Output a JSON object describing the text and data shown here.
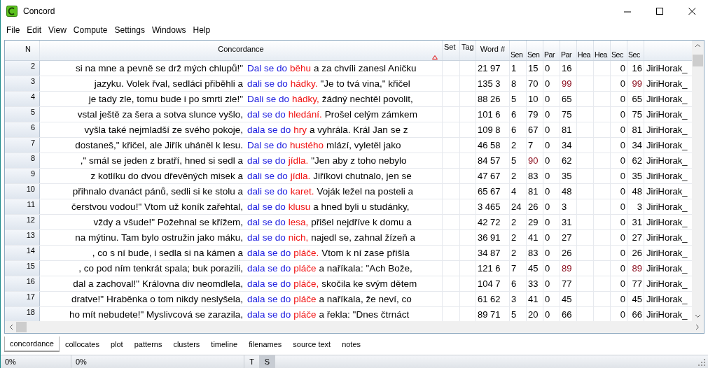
{
  "window": {
    "title": "Concord"
  },
  "menu": [
    "File",
    "Edit",
    "View",
    "Compute",
    "Settings",
    "Windows",
    "Help"
  ],
  "table": {
    "columns": [
      "N",
      "Concordance",
      "Set",
      "Tag",
      "Word #",
      "Sen",
      "Sen",
      "Par",
      "Par",
      "Hea",
      "Hea",
      "Sec",
      "Sec"
    ],
    "rows": [
      {
        "n": "2",
        "left": "si na mne a pevně se drž mých chlupů!\"",
        "node": "Dal se do",
        "collocate": "běhu",
        "right": "a za chvíli zanesl Aničku",
        "word_no": "21 97",
        "sent_1": "1",
        "sent_2": "15",
        "sent_hl": false,
        "para_1": "0",
        "para_2": "16",
        "para_hl": false,
        "sect_1": "0",
        "sect_2": "16",
        "file": "JiriHorak_"
      },
      {
        "n": "3",
        "left": "jazyku. Volek řval, sedláci přiběhli a",
        "node": "dali se do",
        "collocate": "hádky.",
        "right": "\"Je to tvá vina,\" křičel",
        "word_no": "135 3",
        "sent_1": "8",
        "sent_2": "70",
        "sent_hl": false,
        "para_1": "0",
        "para_2": "99",
        "para_hl": true,
        "sect_1": "0",
        "sect_2": "99",
        "file": "JiriHorak_"
      },
      {
        "n": "4",
        "left": "je tady zle, tomu bude i po smrti zle!\"",
        "node": "Dali se do",
        "collocate": "hádky,",
        "right": "žádný nechtěl povolit,",
        "word_no": "88 26",
        "sent_1": "5",
        "sent_2": "10",
        "sent_hl": false,
        "para_1": "0",
        "para_2": "65",
        "para_hl": false,
        "sect_1": "0",
        "sect_2": "65",
        "file": "JiriHorak_"
      },
      {
        "n": "5",
        "left": "vstal ještě za šera a sotva slunce vyšlo,",
        "node": "dal se do",
        "collocate": "hledání.",
        "right": "Prošel celým zámkem",
        "word_no": "101 6",
        "sent_1": "6",
        "sent_2": "79",
        "sent_hl": false,
        "para_1": "0",
        "para_2": "75",
        "para_hl": false,
        "sect_1": "0",
        "sect_2": "75",
        "file": "JiriHorak_"
      },
      {
        "n": "6",
        "left": "vyšla také nejmladší ze svého pokoje,",
        "node": "dala se do",
        "collocate": "hry",
        "right": "a vyhrála. Král Jan se z",
        "word_no": "109 8",
        "sent_1": "6",
        "sent_2": "67",
        "sent_hl": false,
        "para_1": "0",
        "para_2": "81",
        "para_hl": false,
        "sect_1": "0",
        "sect_2": "81",
        "file": "JiriHorak_"
      },
      {
        "n": "7",
        "left": "dostaneš,\" křičel, ale Jiřík uháněl k lesu.",
        "node": "Dal se do",
        "collocate": "hustého",
        "right": "mlází, vyletěl jako",
        "word_no": "46 58",
        "sent_1": "2",
        "sent_2": "7",
        "sent_hl": false,
        "para_1": "0",
        "para_2": "34",
        "para_hl": false,
        "sect_1": "0",
        "sect_2": "34",
        "file": "JiriHorak_"
      },
      {
        "n": "8",
        "left": ",\" smál se jeden z bratří, hned si sedl a",
        "node": "dal se do",
        "collocate": "jídla.",
        "right": "\"Jen aby z toho nebylo",
        "word_no": "84 57",
        "sent_1": "5",
        "sent_2": "90",
        "sent_hl": true,
        "para_1": "0",
        "para_2": "62",
        "para_hl": false,
        "sect_1": "0",
        "sect_2": "62",
        "file": "JiriHorak_"
      },
      {
        "n": "9",
        "left": "z kotlíku do dvou dřevěných misek a",
        "node": "dali se do",
        "collocate": "jídla.",
        "right": "Jiříkovi chutnalo, jen se",
        "word_no": "47 67",
        "sent_1": "2",
        "sent_2": "83",
        "sent_hl": false,
        "para_1": "0",
        "para_2": "35",
        "para_hl": false,
        "sect_1": "0",
        "sect_2": "35",
        "file": "JiriHorak_"
      },
      {
        "n": "10",
        "left": "přihnalo dvanáct pánů, sedli si ke stolu a",
        "node": "dali se do",
        "collocate": "karet.",
        "right": "Voják ležel na posteli a",
        "word_no": "65 67",
        "sent_1": "4",
        "sent_2": "81",
        "sent_hl": false,
        "para_1": "0",
        "para_2": "48",
        "para_hl": false,
        "sect_1": "0",
        "sect_2": "48",
        "file": "JiriHorak_"
      },
      {
        "n": "11",
        "left": "čerstvou vodou!\" Vtom už koník zařehtal,",
        "node": "dal se do",
        "collocate": "klusu",
        "right": "a hned byli u studánky,",
        "word_no": "3 465",
        "sent_1": "24",
        "sent_2": "26",
        "sent_hl": false,
        "para_1": "0",
        "para_2": "3",
        "para_hl": false,
        "sect_1": "0",
        "sect_2": "3",
        "file": "JiriHorak_"
      },
      {
        "n": "12",
        "left": "vždy a všude!\" Požehnal se křížem,",
        "node": "dal se do",
        "collocate": "lesa,",
        "right": "přišel nejdříve k domu a",
        "word_no": "42 72",
        "sent_1": "2",
        "sent_2": "29",
        "sent_hl": false,
        "para_1": "0",
        "para_2": "31",
        "para_hl": false,
        "sect_1": "0",
        "sect_2": "31",
        "file": "JiriHorak_"
      },
      {
        "n": "13",
        "left": "na mýtinu. Tam bylo ostružin jako máku,",
        "node": "dal se do",
        "collocate": "nich,",
        "right": "najedl se, zahnal žízeň a",
        "word_no": "36 91",
        "sent_1": "2",
        "sent_2": "41",
        "sent_hl": false,
        "para_1": "0",
        "para_2": "27",
        "para_hl": false,
        "sect_1": "0",
        "sect_2": "27",
        "file": "JiriHorak_"
      },
      {
        "n": "14",
        "left": ", co s ní bude, i sedla si na kámen a",
        "node": "dala se do",
        "collocate": "pláče.",
        "right": "Vtom k ní zase přišla",
        "word_no": "34 87",
        "sent_1": "2",
        "sent_2": "83",
        "sent_hl": false,
        "para_1": "0",
        "para_2": "26",
        "para_hl": false,
        "sect_1": "0",
        "sect_2": "26",
        "file": "JiriHorak_"
      },
      {
        "n": "15",
        "left": ", co pod ním tenkrát spala; buk porazili,",
        "node": "dala se do",
        "collocate": "pláče",
        "right": "a naříkala: \"Ach Bože,",
        "word_no": "121 6",
        "sent_1": "7",
        "sent_2": "45",
        "sent_hl": false,
        "para_1": "0",
        "para_2": "89",
        "para_hl": true,
        "sect_1": "0",
        "sect_2": "89",
        "file": "JiriHorak_"
      },
      {
        "n": "16",
        "left": "dal a zachoval!\" Královna div neomdlela,",
        "node": "dala se do",
        "collocate": "pláče,",
        "right": "skočila ke svým dětem",
        "word_no": "104 7",
        "sent_1": "6",
        "sent_2": "33",
        "sent_hl": false,
        "para_1": "0",
        "para_2": "77",
        "para_hl": false,
        "sect_1": "0",
        "sect_2": "77",
        "file": "JiriHorak_"
      },
      {
        "n": "17",
        "left": "dratve!\" Hraběnka o tom nikdy neslyšela,",
        "node": "dala se do",
        "collocate": "pláče",
        "right": "a naříkala, že neví, co",
        "word_no": "61 62",
        "sent_1": "3",
        "sent_2": "41",
        "sent_hl": false,
        "para_1": "0",
        "para_2": "45",
        "para_hl": false,
        "sect_1": "0",
        "sect_2": "45",
        "file": "JiriHorak_"
      },
      {
        "n": "18",
        "left": "ho mít nebudete!\" Myslivcová se zarazila,",
        "node": "dala se do",
        "collocate": "pláče",
        "right": "a řekla: \"Dnes čtrnáct",
        "word_no": "89 71",
        "sent_1": "5",
        "sent_2": "20",
        "sent_hl": false,
        "para_1": "0",
        "para_2": "66",
        "para_hl": false,
        "sect_1": "0",
        "sect_2": "66",
        "file": "JiriHorak_"
      }
    ]
  },
  "tabs": [
    {
      "label": "concordance",
      "selected": true
    },
    {
      "label": "collocates",
      "selected": false
    },
    {
      "label": "plot",
      "selected": false
    },
    {
      "label": "patterns",
      "selected": false
    },
    {
      "label": "clusters",
      "selected": false
    },
    {
      "label": "timeline",
      "selected": false
    },
    {
      "label": "filenames",
      "selected": false
    },
    {
      "label": "source text",
      "selected": false
    },
    {
      "label": "notes",
      "selected": false
    }
  ],
  "status_bar": {
    "progress_1": "0%",
    "progress_2": "0%",
    "toggles": [
      {
        "label": "T",
        "selected": false
      },
      {
        "label": "S",
        "selected": true
      }
    ]
  }
}
